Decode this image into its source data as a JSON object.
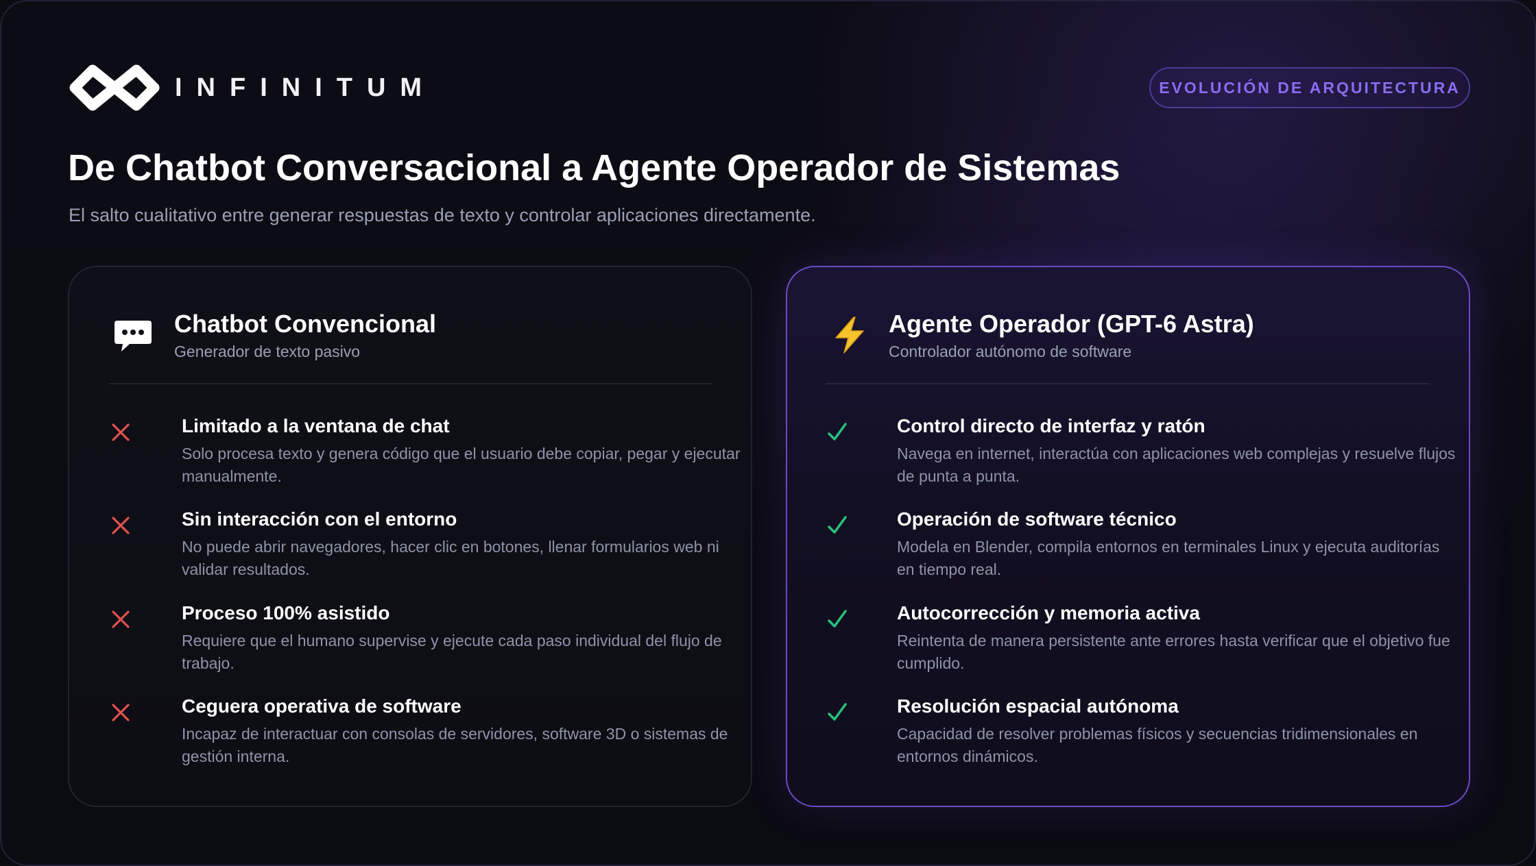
{
  "brand": {
    "name": "INFINITUM"
  },
  "badge": "EVOLUCIÓN DE ARQUITECTURA",
  "title": "De Chatbot Conversacional a Agente Operador de Sistemas",
  "subtitle": "El salto cualitativo entre generar respuestas de texto y controlar aplicaciones directamente.",
  "colors": {
    "accent_purple": "#8b6cf0",
    "cross_red": "#e0524f",
    "check_green": "#27c07a",
    "bolt_yellow": "#f5c32c"
  },
  "left_card": {
    "icon": "speech-bubble-icon",
    "title": "Chatbot Convencional",
    "subtitle": "Generador de texto pasivo",
    "items": [
      {
        "icon": "cross-icon",
        "title": "Limitado a la ventana de chat",
        "desc": "Solo procesa texto y genera código que el usuario debe copiar, pegar y ejecutar manualmente."
      },
      {
        "icon": "cross-icon",
        "title": "Sin interacción con el entorno",
        "desc": "No puede abrir navegadores, hacer clic en botones, llenar formularios web ni validar resultados."
      },
      {
        "icon": "cross-icon",
        "title": "Proceso 100% asistido",
        "desc": "Requiere que el humano supervise y ejecute cada paso individual del flujo de trabajo."
      },
      {
        "icon": "cross-icon",
        "title": "Ceguera operativa de software",
        "desc": "Incapaz de interactuar con consolas de servidores, software 3D o sistemas de gestión interna."
      }
    ]
  },
  "right_card": {
    "icon": "lightning-bolt-icon",
    "title": "Agente Operador (GPT-6 Astra)",
    "subtitle": "Controlador autónomo de software",
    "items": [
      {
        "icon": "check-icon",
        "title": "Control directo de interfaz y ratón",
        "desc": "Navega en internet, interactúa con aplicaciones web complejas y resuelve flujos de punta a punta."
      },
      {
        "icon": "check-icon",
        "title": "Operación de software técnico",
        "desc": "Modela en Blender, compila entornos en terminales Linux y ejecuta auditorías en tiempo real."
      },
      {
        "icon": "check-icon",
        "title": "Autocorrección y memoria activa",
        "desc": "Reintenta de manera persistente ante errores hasta verificar que el objetivo fue cumplido."
      },
      {
        "icon": "check-icon",
        "title": "Resolución espacial autónoma",
        "desc": "Capacidad de resolver problemas físicos y secuencias tridimensionales en entornos dinámicos."
      }
    ]
  }
}
